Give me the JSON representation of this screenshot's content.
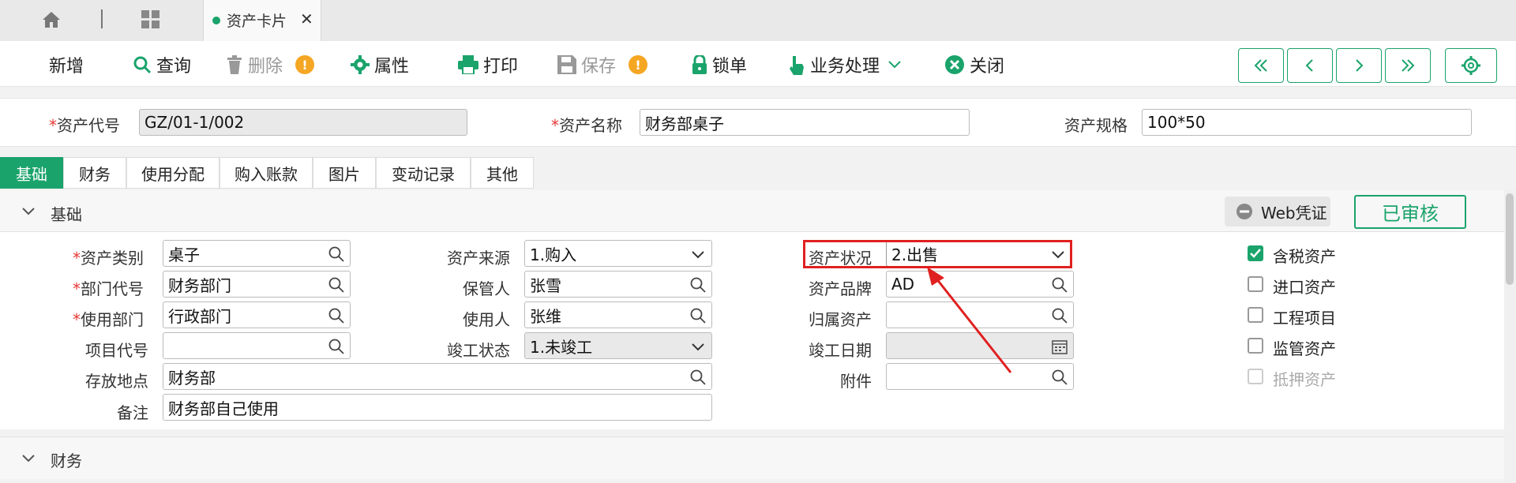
{
  "tabbar": {
    "active_tab": "资产卡片",
    "close": "✕"
  },
  "toolbar": {
    "add": "新增",
    "query": "查询",
    "delete": "删除",
    "properties": "属性",
    "print": "打印",
    "save": "保存",
    "lock": "锁单",
    "business": "业务处理",
    "close": "关闭",
    "warn": "!"
  },
  "header": {
    "asset_code_label": "资产代号",
    "asset_code_value": "GZ/01-1/002",
    "asset_name_label": "资产名称",
    "asset_name_value": "财务部桌子",
    "asset_spec_label": "资产规格",
    "asset_spec_value": "100*50"
  },
  "subtabs": [
    "基础",
    "财务",
    "使用分配",
    "购入账款",
    "图片",
    "变动记录",
    "其他"
  ],
  "section_basic": {
    "title": "基础",
    "web_voucher": "Web凭证",
    "approved": "已审核"
  },
  "fields": {
    "category_label": "资产类别",
    "category_value": "桌子",
    "dept_label": "部门代号",
    "dept_value": "财务部门",
    "use_dept_label": "使用部门",
    "use_dept_value": "行政部门",
    "project_label": "项目代号",
    "project_value": "",
    "location_label": "存放地点",
    "location_value": "财务部",
    "remark_label": "备注",
    "remark_value": "财务部自己使用",
    "source_label": "资产来源",
    "source_value": "1.购入",
    "keeper_label": "保管人",
    "keeper_value": "张雪",
    "user_label": "使用人",
    "user_value": "张维",
    "completion_label": "竣工状态",
    "completion_value": "1.未竣工",
    "status_label": "资产状况",
    "status_value": "2.出售",
    "brand_label": "资产品牌",
    "brand_value": "AD",
    "belong_label": "归属资产",
    "belong_value": "",
    "completion_date_label": "竣工日期",
    "completion_date_value": "",
    "attachment_label": "附件",
    "attachment_value": ""
  },
  "checkboxes": [
    {
      "label": "含税资产",
      "checked": true,
      "disabled": false
    },
    {
      "label": "进口资产",
      "checked": false,
      "disabled": false
    },
    {
      "label": "工程项目",
      "checked": false,
      "disabled": false
    },
    {
      "label": "监管资产",
      "checked": false,
      "disabled": false
    },
    {
      "label": "抵押资产",
      "checked": false,
      "disabled": true
    }
  ],
  "section_finance": {
    "title": "财务"
  },
  "required_mark": "*",
  "colors": {
    "accent": "#1aa36b",
    "highlight": "#e02020",
    "warning": "#f5a623"
  }
}
